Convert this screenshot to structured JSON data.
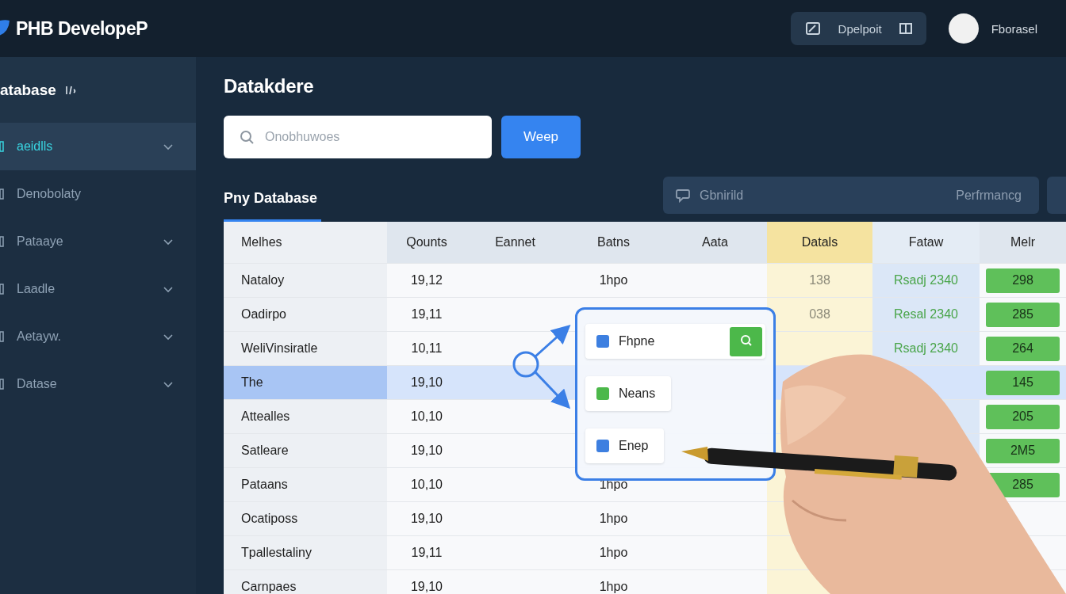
{
  "topbar": {
    "brand": "PHB DevelopeP",
    "action_button": "Dpelpoit",
    "user_name": "Fborasel"
  },
  "sidebar": {
    "title": "atabase",
    "items": [
      {
        "label": "aeidlls",
        "selected": true,
        "expandable": true
      },
      {
        "label": "Denobolaty",
        "selected": false,
        "expandable": false
      },
      {
        "label": "Pataaye",
        "selected": false,
        "expandable": true
      },
      {
        "label": "Laadle",
        "selected": false,
        "expandable": true
      },
      {
        "label": "Aetayw.",
        "selected": false,
        "expandable": true
      },
      {
        "label": "Datase",
        "selected": false,
        "expandable": true
      }
    ]
  },
  "main": {
    "heading": "Datakdere",
    "search": {
      "placeholder": "Onobhuwoes"
    },
    "search_button": "Weep",
    "tabs": [
      {
        "label": "Pny Database",
        "selected": true
      }
    ],
    "filter_bar": {
      "label": "Gbnirild",
      "value": "Perfrmancg"
    },
    "table": {
      "columns": [
        "Melhes",
        "Qounts",
        "Eannet",
        "Batns",
        "Aata",
        "Datals",
        "Fataw",
        "Melr"
      ],
      "rows": [
        {
          "selected": false,
          "cells": [
            "Nataloy",
            "19,12",
            null,
            "1hpo",
            null,
            "138",
            "Rsadj 2340",
            "298"
          ]
        },
        {
          "selected": false,
          "cells": [
            "Oadirpo",
            "19,11",
            null,
            null,
            null,
            "038",
            "Resal 2340",
            "285"
          ]
        },
        {
          "selected": false,
          "cells": [
            "WeliVinsiratle",
            "10,11",
            null,
            null,
            null,
            null,
            "Rsadj 2340",
            "264"
          ]
        },
        {
          "selected": true,
          "cells": [
            "The",
            "19,10",
            null,
            null,
            null,
            null,
            null,
            "145"
          ]
        },
        {
          "selected": false,
          "cells": [
            "Attealles",
            "10,10",
            null,
            null,
            null,
            null,
            null,
            "205"
          ]
        },
        {
          "selected": false,
          "cells": [
            "Satleare",
            "19,10",
            null,
            null,
            null,
            null,
            null,
            "2M5"
          ]
        },
        {
          "selected": false,
          "cells": [
            "Pataans",
            "10,10",
            null,
            "1hpo",
            null,
            null,
            null,
            "285"
          ]
        },
        {
          "selected": false,
          "cells": [
            "Ocatiposs",
            "19,10",
            null,
            "1hpo",
            null,
            null,
            null,
            null
          ]
        },
        {
          "selected": false,
          "cells": [
            "Tpallestaliny",
            "19,11",
            null,
            "1hpo",
            null,
            null,
            null,
            null
          ]
        },
        {
          "selected": false,
          "cells": [
            "Carnpaes",
            "19,10",
            null,
            "1hpo",
            null,
            null,
            null,
            null
          ]
        }
      ]
    },
    "popup": {
      "items": [
        {
          "label": "Fhpne",
          "checked": true,
          "color": "#3d7fe0",
          "kind": "search"
        },
        {
          "label": "Neans",
          "checked": true,
          "color": "#4cb84a",
          "kind": "plain"
        },
        {
          "label": "Enep",
          "checked": true,
          "color": "#3d7fe0",
          "kind": "plain"
        }
      ]
    }
  }
}
